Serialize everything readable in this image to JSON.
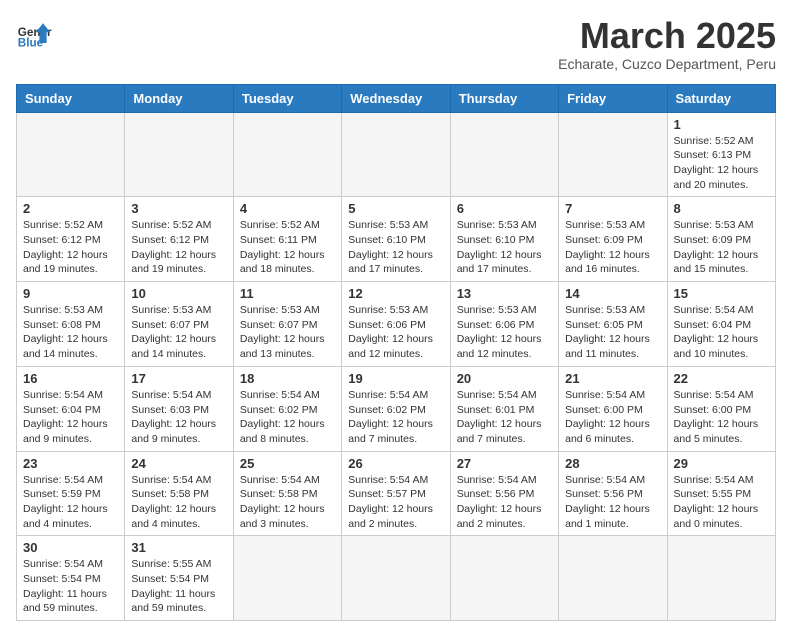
{
  "logo": {
    "general": "General",
    "blue": "Blue"
  },
  "header": {
    "title": "March 2025",
    "subtitle": "Echarate, Cuzco Department, Peru"
  },
  "weekdays": [
    "Sunday",
    "Monday",
    "Tuesday",
    "Wednesday",
    "Thursday",
    "Friday",
    "Saturday"
  ],
  "weeks": [
    [
      {
        "day": "",
        "info": ""
      },
      {
        "day": "",
        "info": ""
      },
      {
        "day": "",
        "info": ""
      },
      {
        "day": "",
        "info": ""
      },
      {
        "day": "",
        "info": ""
      },
      {
        "day": "",
        "info": ""
      },
      {
        "day": "1",
        "info": "Sunrise: 5:52 AM\nSunset: 6:13 PM\nDaylight: 12 hours and 20 minutes."
      }
    ],
    [
      {
        "day": "2",
        "info": "Sunrise: 5:52 AM\nSunset: 6:12 PM\nDaylight: 12 hours and 19 minutes."
      },
      {
        "day": "3",
        "info": "Sunrise: 5:52 AM\nSunset: 6:12 PM\nDaylight: 12 hours and 19 minutes."
      },
      {
        "day": "4",
        "info": "Sunrise: 5:52 AM\nSunset: 6:11 PM\nDaylight: 12 hours and 18 minutes."
      },
      {
        "day": "5",
        "info": "Sunrise: 5:53 AM\nSunset: 6:10 PM\nDaylight: 12 hours and 17 minutes."
      },
      {
        "day": "6",
        "info": "Sunrise: 5:53 AM\nSunset: 6:10 PM\nDaylight: 12 hours and 17 minutes."
      },
      {
        "day": "7",
        "info": "Sunrise: 5:53 AM\nSunset: 6:09 PM\nDaylight: 12 hours and 16 minutes."
      },
      {
        "day": "8",
        "info": "Sunrise: 5:53 AM\nSunset: 6:09 PM\nDaylight: 12 hours and 15 minutes."
      }
    ],
    [
      {
        "day": "9",
        "info": "Sunrise: 5:53 AM\nSunset: 6:08 PM\nDaylight: 12 hours and 14 minutes."
      },
      {
        "day": "10",
        "info": "Sunrise: 5:53 AM\nSunset: 6:07 PM\nDaylight: 12 hours and 14 minutes."
      },
      {
        "day": "11",
        "info": "Sunrise: 5:53 AM\nSunset: 6:07 PM\nDaylight: 12 hours and 13 minutes."
      },
      {
        "day": "12",
        "info": "Sunrise: 5:53 AM\nSunset: 6:06 PM\nDaylight: 12 hours and 12 minutes."
      },
      {
        "day": "13",
        "info": "Sunrise: 5:53 AM\nSunset: 6:06 PM\nDaylight: 12 hours and 12 minutes."
      },
      {
        "day": "14",
        "info": "Sunrise: 5:53 AM\nSunset: 6:05 PM\nDaylight: 12 hours and 11 minutes."
      },
      {
        "day": "15",
        "info": "Sunrise: 5:54 AM\nSunset: 6:04 PM\nDaylight: 12 hours and 10 minutes."
      }
    ],
    [
      {
        "day": "16",
        "info": "Sunrise: 5:54 AM\nSunset: 6:04 PM\nDaylight: 12 hours and 9 minutes."
      },
      {
        "day": "17",
        "info": "Sunrise: 5:54 AM\nSunset: 6:03 PM\nDaylight: 12 hours and 9 minutes."
      },
      {
        "day": "18",
        "info": "Sunrise: 5:54 AM\nSunset: 6:02 PM\nDaylight: 12 hours and 8 minutes."
      },
      {
        "day": "19",
        "info": "Sunrise: 5:54 AM\nSunset: 6:02 PM\nDaylight: 12 hours and 7 minutes."
      },
      {
        "day": "20",
        "info": "Sunrise: 5:54 AM\nSunset: 6:01 PM\nDaylight: 12 hours and 7 minutes."
      },
      {
        "day": "21",
        "info": "Sunrise: 5:54 AM\nSunset: 6:00 PM\nDaylight: 12 hours and 6 minutes."
      },
      {
        "day": "22",
        "info": "Sunrise: 5:54 AM\nSunset: 6:00 PM\nDaylight: 12 hours and 5 minutes."
      }
    ],
    [
      {
        "day": "23",
        "info": "Sunrise: 5:54 AM\nSunset: 5:59 PM\nDaylight: 12 hours and 4 minutes."
      },
      {
        "day": "24",
        "info": "Sunrise: 5:54 AM\nSunset: 5:58 PM\nDaylight: 12 hours and 4 minutes."
      },
      {
        "day": "25",
        "info": "Sunrise: 5:54 AM\nSunset: 5:58 PM\nDaylight: 12 hours and 3 minutes."
      },
      {
        "day": "26",
        "info": "Sunrise: 5:54 AM\nSunset: 5:57 PM\nDaylight: 12 hours and 2 minutes."
      },
      {
        "day": "27",
        "info": "Sunrise: 5:54 AM\nSunset: 5:56 PM\nDaylight: 12 hours and 2 minutes."
      },
      {
        "day": "28",
        "info": "Sunrise: 5:54 AM\nSunset: 5:56 PM\nDaylight: 12 hours and 1 minute."
      },
      {
        "day": "29",
        "info": "Sunrise: 5:54 AM\nSunset: 5:55 PM\nDaylight: 12 hours and 0 minutes."
      }
    ],
    [
      {
        "day": "30",
        "info": "Sunrise: 5:54 AM\nSunset: 5:54 PM\nDaylight: 11 hours and 59 minutes."
      },
      {
        "day": "31",
        "info": "Sunrise: 5:55 AM\nSunset: 5:54 PM\nDaylight: 11 hours and 59 minutes."
      },
      {
        "day": "",
        "info": ""
      },
      {
        "day": "",
        "info": ""
      },
      {
        "day": "",
        "info": ""
      },
      {
        "day": "",
        "info": ""
      },
      {
        "day": "",
        "info": ""
      }
    ]
  ]
}
